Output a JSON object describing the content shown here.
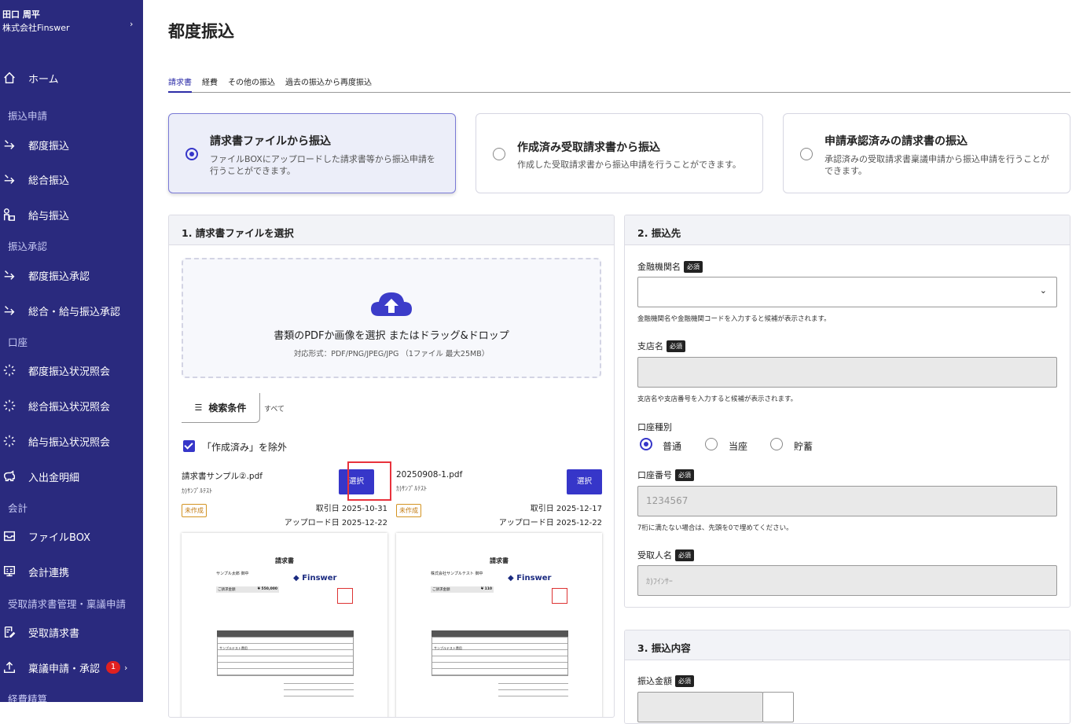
{
  "user": {
    "name": "田口 周平",
    "company": "株式会社Finswer"
  },
  "nav": {
    "home": "ホーム",
    "sec_transfer": "振込申請",
    "tsudo": "都度振込",
    "sogo": "総合振込",
    "kyuyo": "給与振込",
    "sec_approval": "振込承認",
    "tsudo_approval": "都度振込承認",
    "sogo_kyuyo_approval": "総合・給与振込承認",
    "sec_account": "口座",
    "tsudo_status": "都度振込状況照会",
    "sogo_status": "総合振込状況照会",
    "kyuyo_status": "給与振込状況照会",
    "statement": "入出金明細",
    "sec_accounting": "会計",
    "filebox": "ファイルBOX",
    "accounting_link": "会計連携",
    "sec_invoice": "受取請求書管理・稟議申請",
    "received_invoice": "受取請求書",
    "ringi": "稟議申請・承認",
    "ringi_badge": "1",
    "sec_expense": "経費精算"
  },
  "page": {
    "title": "都度振込"
  },
  "tabs": [
    "請求書",
    "経費",
    "その他の振込",
    "過去の振込から再度振込"
  ],
  "options": [
    {
      "title": "請求書ファイルから振込",
      "desc1": "ファイルBOXにアップロードした請求書等から振込申請を",
      "desc2": "行うことができます。"
    },
    {
      "title": "作成済み受取請求書から振込",
      "desc1": "作成した受取請求書から振込申請を行うことができます。",
      "desc2": ""
    },
    {
      "title": "申請承認済みの請求書の振込",
      "desc1": "承認済みの受取請求書稟議申請から振込申請を行うことが",
      "desc2": "できます。"
    }
  ],
  "left_panel": {
    "title": "1. 請求書ファイルを選択",
    "drop_main": "書類のPDFか画像を選択 またはドラッグ&ドロップ",
    "drop_sub": "対応形式：PDF/PNG/JPEG/JPG （1ファイル 最大25MB）",
    "filter_label": "検索条件",
    "filter_value": "すべて",
    "exclude_label": "「作成済み」を除外",
    "cards": [
      {
        "file": "請求書サンプル②.pdf",
        "company": "ｶ)ｻﾝﾌﾟﾙﾃｽﾄ",
        "button": "選択",
        "status": "未作成",
        "trade": "取引日 2025-10-31",
        "upload": "アップロード日 2025-12-22",
        "thumb_company": "サンプル太郎 御中",
        "thumb_amount": "¥ 550,000",
        "thumb_row": "サンプルテスト費用"
      },
      {
        "file": "20250908-1.pdf",
        "company": "ｶ)ｻﾝﾌﾟﾙﾃｽﾄ",
        "button": "選択",
        "status": "未作成",
        "trade": "取引日 2025-12-17",
        "upload": "アップロード日 2025-12-22",
        "thumb_company": "株式会社サンプルテスト 御中",
        "thumb_amount": "¥ 110",
        "thumb_row": "サンプルテスト費用"
      }
    ],
    "thumb_title": "請求書",
    "thumb_logo": "Finswer",
    "thumb_amount_label": "ご請求金額"
  },
  "right_panel": {
    "title": "2. 振込先",
    "required": "必須",
    "bank_label": "金融機関名",
    "bank_help": "金融機関名や金融機関コードを入力すると候補が表示されます。",
    "branch_label": "支店名",
    "branch_help": "支店名や支店番号を入力すると候補が表示されます。",
    "type_label": "口座種別",
    "types": [
      "普通",
      "当座",
      "貯蓄"
    ],
    "number_label": "口座番号",
    "number_placeholder": "1234567",
    "number_help": "7桁に満たない場合は、先頭を0で埋めてください。",
    "recipient_label": "受取人名",
    "recipient_placeholder": "ｶ)ﾌｲﾝｻｰ"
  },
  "amount_panel": {
    "title": "3. 振込内容",
    "amount_label": "振込金額"
  },
  "colors": {
    "sidebar": "#2a2a7e",
    "accent": "#3636c9",
    "highlight": "#e8323c"
  }
}
